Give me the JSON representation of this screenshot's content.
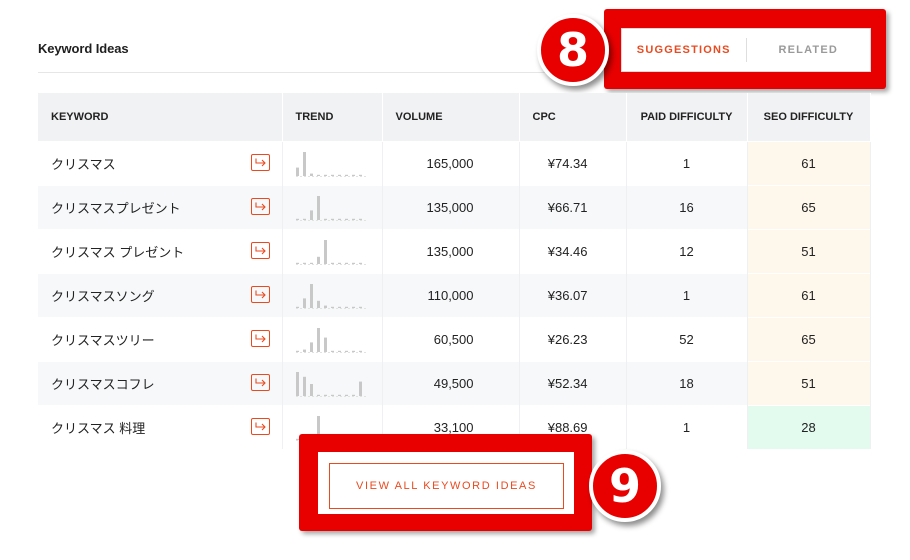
{
  "section": {
    "title": "Keyword Ideas"
  },
  "tabs": [
    {
      "label": "SUGGESTIONS",
      "active": true
    },
    {
      "label": "RELATED",
      "active": false
    }
  ],
  "annotations": {
    "badge_tabs": "8",
    "badge_view_all": "9"
  },
  "table": {
    "columns": [
      "KEYWORD",
      "TREND",
      "VOLUME",
      "CPC",
      "PAID DIFFICULTY",
      "SEO DIFFICULTY"
    ],
    "rows": [
      {
        "keyword": "クリスマス",
        "volume": "165,000",
        "cpc": "¥74.34",
        "paid": "1",
        "seo": "61",
        "trend": [
          0.35,
          1.0,
          0.1,
          0.05,
          0.05,
          0.05,
          0.05,
          0.05,
          0.05,
          0.05
        ]
      },
      {
        "keyword": "クリスマスプレゼント",
        "volume": "135,000",
        "cpc": "¥66.71",
        "paid": "16",
        "seo": "65",
        "trend": [
          0.05,
          0.05,
          0.4,
          1.0,
          0.05,
          0.05,
          0.05,
          0.05,
          0.05,
          0.05
        ]
      },
      {
        "keyword": "クリスマス プレゼント",
        "volume": "135,000",
        "cpc": "¥34.46",
        "paid": "12",
        "seo": "51",
        "trend": [
          0.05,
          0.05,
          0.05,
          0.3,
          1.0,
          0.05,
          0.05,
          0.05,
          0.05,
          0.05
        ]
      },
      {
        "keyword": "クリスマスソング",
        "volume": "110,000",
        "cpc": "¥36.07",
        "paid": "1",
        "seo": "61",
        "trend": [
          0.05,
          0.4,
          1.0,
          0.3,
          0.1,
          0.05,
          0.05,
          0.05,
          0.05,
          0.05
        ]
      },
      {
        "keyword": "クリスマスツリー",
        "volume": "60,500",
        "cpc": "¥26.23",
        "paid": "52",
        "seo": "65",
        "trend": [
          0.05,
          0.1,
          0.4,
          1.0,
          0.6,
          0.05,
          0.05,
          0.05,
          0.05,
          0.05
        ]
      },
      {
        "keyword": "クリスマスコフレ",
        "volume": "49,500",
        "cpc": "¥52.34",
        "paid": "18",
        "seo": "51",
        "trend": [
          1.0,
          0.8,
          0.5,
          0.05,
          0.05,
          0.05,
          0.05,
          0.05,
          0.05,
          0.6
        ]
      },
      {
        "keyword": "クリスマス 料理",
        "volume": "33,100",
        "cpc": "¥88.69",
        "paid": "1",
        "seo": "28",
        "trend": [
          0.05,
          0.05,
          0.05,
          1.0,
          0.05,
          0.05,
          0.05,
          0.05,
          0.05,
          0.05
        ]
      }
    ]
  },
  "view_all": {
    "label": "VIEW ALL KEYWORD IDEAS"
  },
  "colors": {
    "accent": "#ea4a1f",
    "annotation": "#e80000",
    "seo_hard_bg": "#fef8ec",
    "seo_easy_bg": "#e3fbef",
    "trend_bar": "#c8c8c8"
  },
  "icons": {
    "row_action": "external-arrow-icon"
  }
}
